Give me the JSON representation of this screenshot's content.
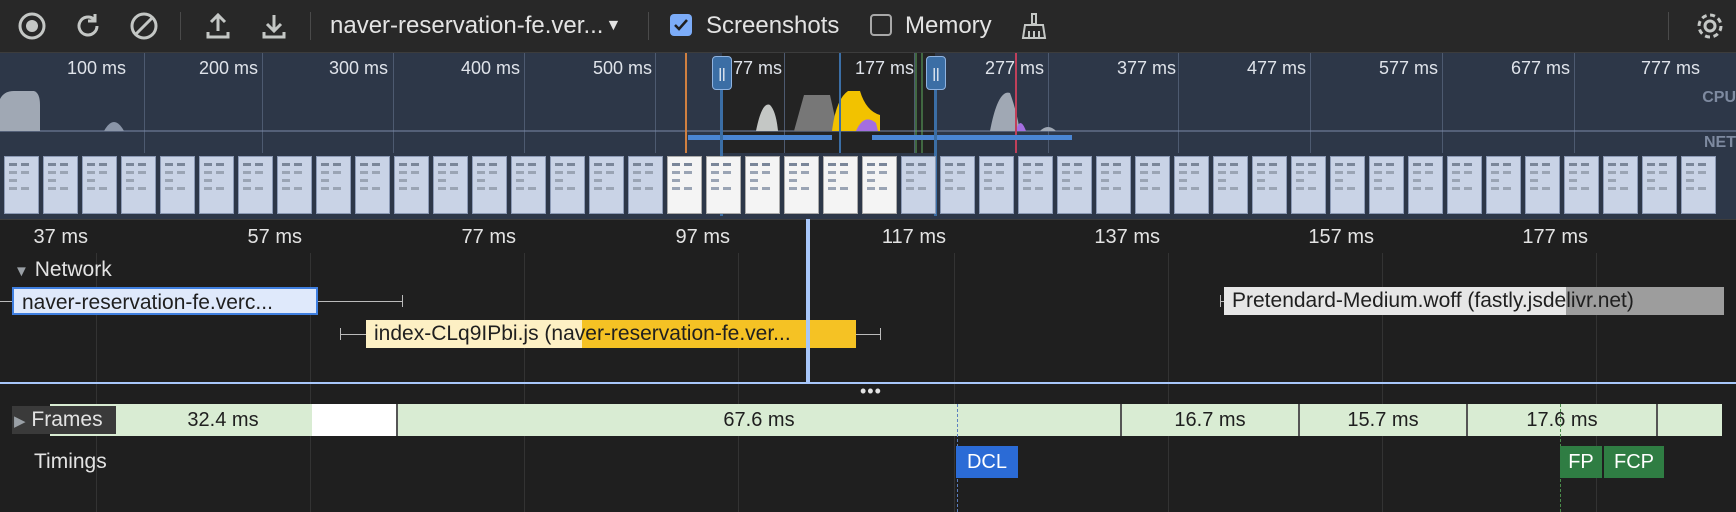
{
  "toolbar": {
    "record_icon": "record-icon",
    "reload_icon": "reload-icon",
    "clear_icon": "clear-icon",
    "upload_icon": "upload-icon",
    "download_icon": "download-icon",
    "recording_select": "naver-reservation-fe.ver...",
    "screenshots_label": "Screenshots",
    "screenshots_checked": true,
    "memory_label": "Memory",
    "memory_checked": false,
    "gc_icon": "broom-icon",
    "settings_icon": "gear-icon"
  },
  "overview": {
    "labels": [
      "100 ms",
      "200 ms",
      "300 ms",
      "400 ms",
      "500 ms",
      "77 ms",
      "177 ms",
      "277 ms",
      "377 ms",
      "477 ms",
      "577 ms",
      "677 ms",
      "777 ms"
    ],
    "cpu_label": "CPU",
    "net_label": "NET",
    "handle_glyph": "||"
  },
  "ruler": {
    "labels": [
      "37 ms",
      "57 ms",
      "77 ms",
      "97 ms",
      "117 ms",
      "137 ms",
      "157 ms",
      "177 ms"
    ]
  },
  "network": {
    "header": "Network",
    "requests": [
      {
        "label": "naver-reservation-fe.verc..."
      },
      {
        "label": "index-CLq9IPbi.js (naver-reservation-fe.ver..."
      },
      {
        "label": "Pretendard-Medium.woff (fastly.jsdelivr.net)"
      }
    ]
  },
  "frames": {
    "label": "Frames",
    "items": [
      "32.4 ms",
      "67.6 ms",
      "16.7 ms",
      "15.7 ms",
      "17.6 ms"
    ]
  },
  "timings": {
    "label": "Timings",
    "markers": [
      {
        "label": "DCL",
        "color": "#2b6bd6"
      },
      {
        "label": "FP",
        "color": "#2f7d43"
      },
      {
        "label": "FCP",
        "color": "#2f7d43"
      }
    ]
  }
}
